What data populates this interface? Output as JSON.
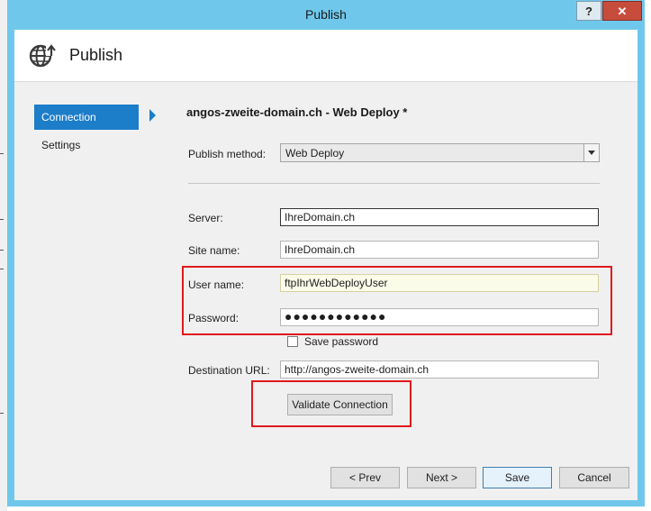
{
  "window": {
    "title": "Publish",
    "help_label": "?",
    "close_label": "✕"
  },
  "header": {
    "title": "Publish",
    "icon": "globe-publish-icon"
  },
  "sidebar": {
    "items": [
      {
        "label": "Connection",
        "active": true
      },
      {
        "label": "Settings",
        "active": false
      }
    ]
  },
  "main": {
    "profile_title": "angos-zweite-domain.ch - Web Deploy *",
    "publish_method": {
      "label": "Publish method:",
      "value": "Web Deploy"
    },
    "server": {
      "label": "Server:",
      "value": "IhreDomain.ch"
    },
    "site_name": {
      "label": "Site name:",
      "value": "IhreDomain.ch"
    },
    "user_name": {
      "label": "User name:",
      "value": "ftpIhrWebDeployUser"
    },
    "password": {
      "label": "Password:",
      "value": "●●●●●●●●●●●●"
    },
    "save_password": {
      "label": "Save password",
      "checked": false
    },
    "destination_url": {
      "label": "Destination URL:",
      "value": "http://angos-zweite-domain.ch"
    },
    "validate_label": "Validate Connection"
  },
  "footer": {
    "prev_label": "< Prev",
    "next_label": "Next >",
    "save_label": "Save",
    "cancel_label": "Cancel"
  },
  "colors": {
    "titlebar": "#6fc8ec",
    "accent": "#1c7dc9",
    "highlight": "#e0181b",
    "close": "#c74c3c"
  }
}
